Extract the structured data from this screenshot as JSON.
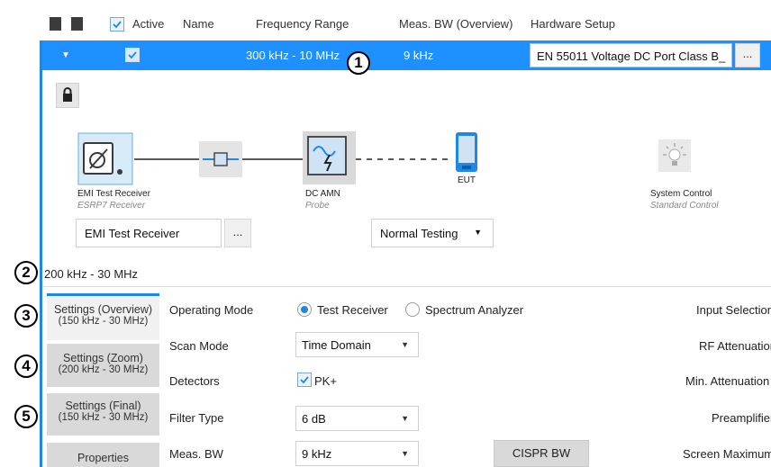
{
  "header": {
    "columns": {
      "active": "Active",
      "name": "Name",
      "frequency": "Frequency Range",
      "meas_bw": "Meas. BW (Overview)",
      "hardware": "Hardware Setup"
    }
  },
  "row": {
    "expand_glyph": "▼",
    "frequency": "300 kHz - 10 MHz",
    "meas_bw": "9 kHz",
    "hardware_value": "EN 55011 Voltage DC Port Class B_",
    "more_label": "..."
  },
  "callouts": [
    "1",
    "2",
    "3",
    "4",
    "5"
  ],
  "diagram": {
    "receiver_title": "EMI Test Receiver",
    "receiver_sub": "ESRP7 Receiver",
    "amn_title": "DC AMN",
    "amn_sub": "Probe",
    "eut_title": "EUT",
    "system_title": "System Control",
    "system_sub": "Standard Control",
    "receiver_select": "EMI Test Receiver",
    "receiver_more": "...",
    "testing_mode": "Normal Testing"
  },
  "range_label": "200 kHz - 30 MHz",
  "tabs": [
    {
      "line1": "Settings (Overview)",
      "line2": "(150 kHz - 30 MHz)"
    },
    {
      "line1": "Settings (Zoom)",
      "line2": "(200 kHz - 30 MHz)"
    },
    {
      "line1": "Settings (Final)",
      "line2": "(150 kHz - 30 MHz)"
    },
    {
      "line1": "Properties",
      "line2": ""
    }
  ],
  "settings": {
    "operating_mode_label": "Operating Mode",
    "mode_options": [
      "Test Receiver",
      "Spectrum Analyzer"
    ],
    "scan_mode_label": "Scan Mode",
    "scan_mode_value": "Time Domain",
    "detectors_label": "Detectors",
    "detector_value": "PK+",
    "filter_type_label": "Filter Type",
    "filter_type_value": "6 dB",
    "meas_bw_label": "Meas. BW",
    "meas_bw_value": "9 kHz",
    "cispr_button": "CISPR BW"
  },
  "right_labels": [
    "Input Selection",
    "RF Attenuation",
    "Min. Attenuation",
    "Preamplifier",
    "Screen Maximum"
  ],
  "colors": {
    "accent": "#1e90ff",
    "tab_active_border": "#1e88e5"
  }
}
